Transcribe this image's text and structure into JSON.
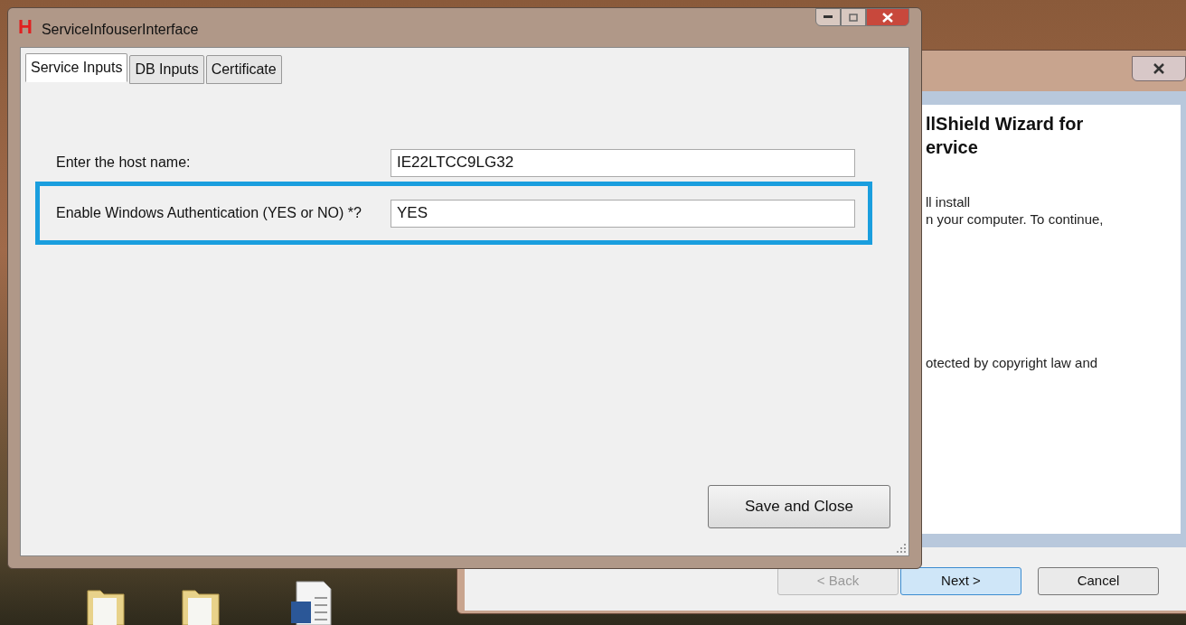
{
  "main_window": {
    "app_icon": "H",
    "title": "ServiceInfouserInterface",
    "tabs": [
      {
        "label": "Service Inputs",
        "selected": true
      },
      {
        "label": "DB Inputs",
        "selected": false
      },
      {
        "label": "Certificate",
        "selected": false
      }
    ],
    "fields": [
      {
        "label": "Enter the host name:",
        "value": "IE22LTCC9LG32",
        "highlighted": false
      },
      {
        "label": "Enable Windows Authentication (YES or NO) *?",
        "value": "YES",
        "highlighted": true
      }
    ],
    "buttons": [
      "Save and Close"
    ]
  },
  "wizard_window": {
    "heading_lines": [
      "llShield Wizard for",
      "ervice"
    ],
    "paragraphs": [
      "ll install\nn your computer. To continue,",
      "otected by copyright law and"
    ],
    "buttons": [
      {
        "label": "< Back",
        "disabled": true,
        "selected": false
      },
      {
        "label": "Next >",
        "disabled": false,
        "selected": true
      },
      {
        "label": "Cancel",
        "disabled": false,
        "selected": false
      }
    ]
  }
}
